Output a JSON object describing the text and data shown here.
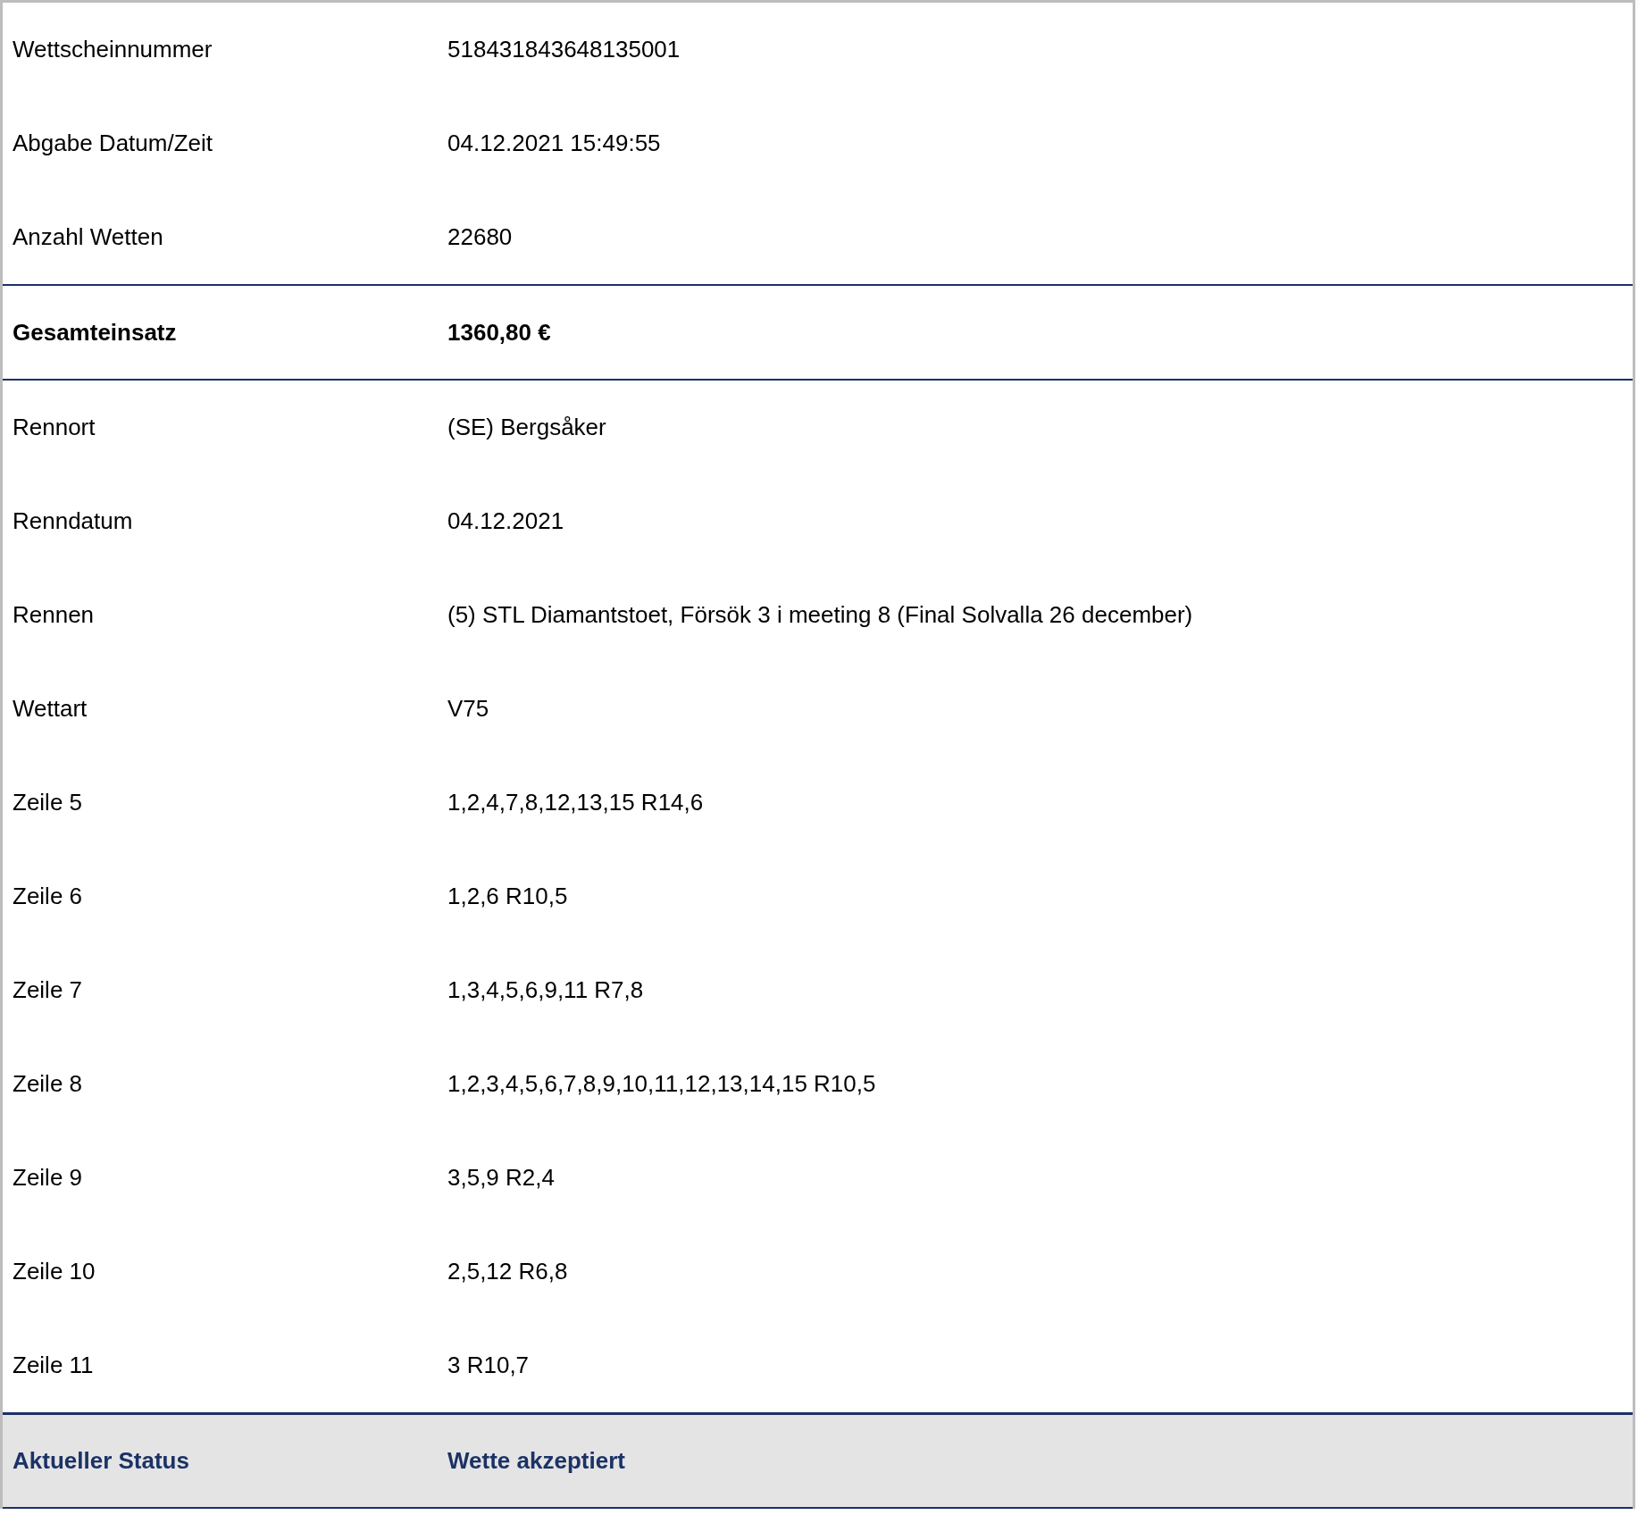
{
  "rows": [
    {
      "kind": "normal",
      "label": "Wettscheinnummer",
      "value": "518431843648135001"
    },
    {
      "kind": "normal",
      "label": "Abgabe Datum/Zeit",
      "value": "04.12.2021 15:49:55"
    },
    {
      "kind": "normal",
      "label": "Anzahl Wetten",
      "value": "22680"
    },
    {
      "kind": "total",
      "label": "Gesamteinsatz",
      "value": "1360,80 €"
    },
    {
      "kind": "normal",
      "label": "Rennort",
      "value": "(SE) Bergsåker"
    },
    {
      "kind": "normal",
      "label": "Renndatum",
      "value": "04.12.2021"
    },
    {
      "kind": "normal",
      "label": "Rennen",
      "value": "(5) STL Diamantstoet, Försök 3 i meeting 8 (Final Solvalla 26 december)"
    },
    {
      "kind": "normal",
      "label": "Wettart",
      "value": "V75"
    },
    {
      "kind": "normal",
      "label": "Zeile 5",
      "value": "1,2,4,7,8,12,13,15 R14,6"
    },
    {
      "kind": "normal",
      "label": "Zeile 6",
      "value": "1,2,6 R10,5"
    },
    {
      "kind": "normal",
      "label": "Zeile 7",
      "value": "1,3,4,5,6,9,11 R7,8"
    },
    {
      "kind": "normal",
      "label": "Zeile 8",
      "value": "1,2,3,4,5,6,7,8,9,10,11,12,13,14,15 R10,5"
    },
    {
      "kind": "normal",
      "label": "Zeile 9",
      "value": "3,5,9 R2,4"
    },
    {
      "kind": "normal",
      "label": "Zeile 10",
      "value": "2,5,12 R6,8"
    },
    {
      "kind": "normal",
      "label": "Zeile 11",
      "value": "3 R10,7"
    },
    {
      "kind": "status",
      "label": "Aktueller Status",
      "value": "Wette akzeptiert"
    }
  ]
}
